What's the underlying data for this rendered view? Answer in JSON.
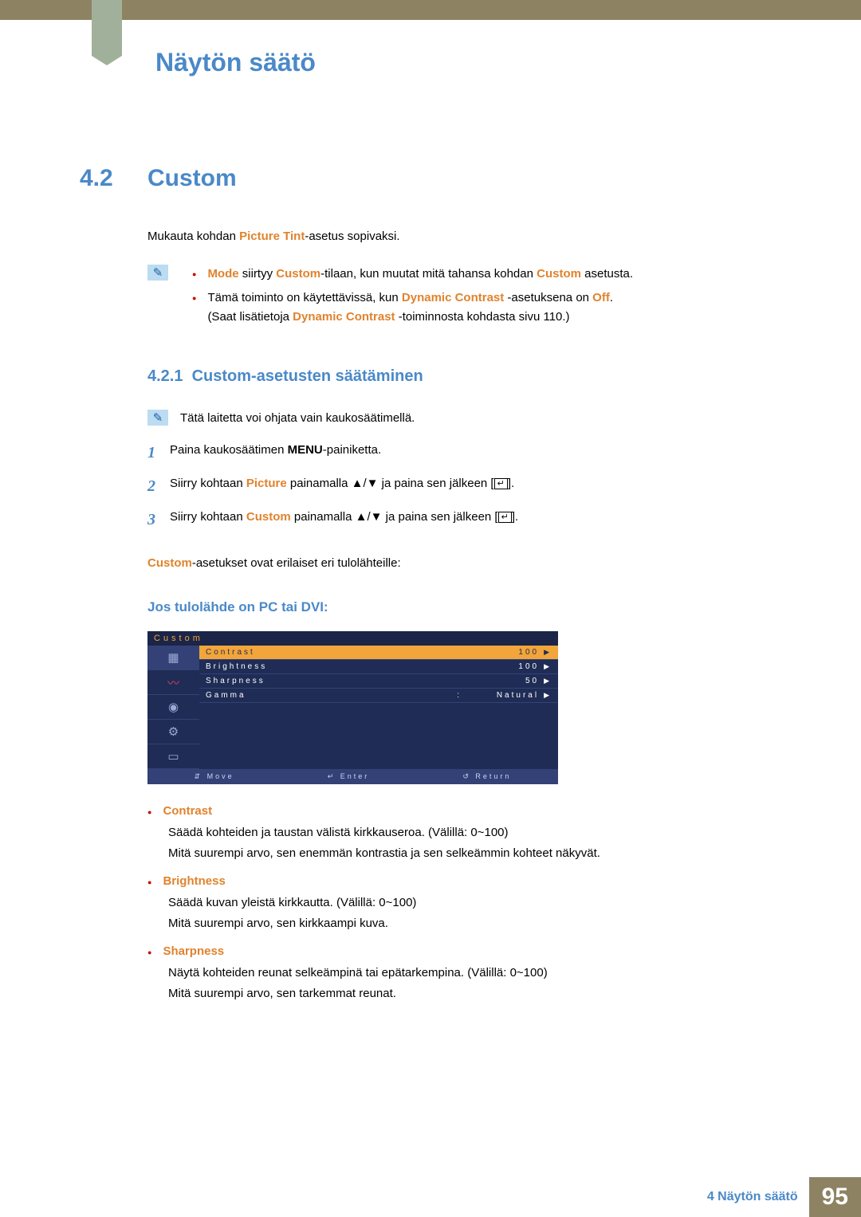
{
  "header": {
    "chapter_title": "Näytön säätö"
  },
  "section": {
    "num": "4.2",
    "title": "Custom"
  },
  "intro": {
    "pre": "Mukauta kohdan ",
    "picture_tint": "Picture Tint",
    "post": "-asetus sopivaksi."
  },
  "notes1": [
    {
      "mode": "Mode",
      "t1": " siirtyy ",
      "custom": "Custom",
      "t2": "-tilaan, kun muutat mitä tahansa kohdan ",
      "custom2": "Custom",
      "t3": " asetusta."
    },
    {
      "t1": "Tämä toiminto on käytettävissä, kun ",
      "dc": "Dynamic Contrast",
      "t2": " -asetuksena on ",
      "off": "Off",
      "t3": ".",
      "line2a": "(Saat lisätietoja ",
      "dc2": "Dynamic Contrast",
      "line2b": " -toiminnosta kohdasta sivu 110.)"
    }
  ],
  "subsection": {
    "num": "4.2.1",
    "title": "Custom-asetusten säätäminen"
  },
  "note2": "Tätä laitetta voi ohjata vain kaukosäätimellä.",
  "steps": [
    {
      "n": "1",
      "pre": "Paina kaukosäätimen ",
      "bold": "MENU",
      "post": "-painiketta."
    },
    {
      "n": "2",
      "pre": "Siirry kohtaan ",
      "kw": "Picture",
      "mid": " painamalla ",
      "arrows": "▲/▼",
      "post": " ja paina sen jälkeen [",
      "enter": "↵",
      "end": "]."
    },
    {
      "n": "3",
      "pre": "Siirry kohtaan ",
      "kw": "Custom",
      "mid": " painamalla ",
      "arrows": "▲/▼",
      "post": " ja paina sen jälkeen [",
      "enter": "↵",
      "end": "]."
    }
  ],
  "para_after_steps": {
    "kw": "Custom",
    "text": "-asetukset ovat erilaiset eri tulolähteille:"
  },
  "subheading": "Jos tulolähde on PC tai DVI:",
  "osd": {
    "title": "Custom",
    "rows": [
      {
        "label": "Contrast",
        "value": "100",
        "sel": true
      },
      {
        "label": "Brightness",
        "value": "100"
      },
      {
        "label": "Sharpness",
        "value": "50"
      },
      {
        "label": "Gamma",
        "colon": ":",
        "value": "Natural"
      }
    ],
    "footer": {
      "move": "Move",
      "enter": "Enter",
      "ret": "Return"
    }
  },
  "descriptions": [
    {
      "title": "Contrast",
      "lines": [
        "Säädä kohteiden ja taustan välistä kirkkauseroa. (Välillä: 0~100)",
        "Mitä suurempi arvo, sen enemmän kontrastia ja sen selkeämmin kohteet näkyvät."
      ]
    },
    {
      "title": "Brightness",
      "lines": [
        "Säädä kuvan yleistä kirkkautta. (Välillä: 0~100)",
        "Mitä suurempi arvo, sen kirkkaampi kuva."
      ]
    },
    {
      "title": "Sharpness",
      "lines": [
        "Näytä kohteiden reunat selkeämpinä tai epätarkempina. (Välillä: 0~100)",
        "Mitä suurempi arvo, sen tarkemmat reunat."
      ]
    }
  ],
  "footer": {
    "text": "4 Näytön säätö",
    "page": "95"
  }
}
